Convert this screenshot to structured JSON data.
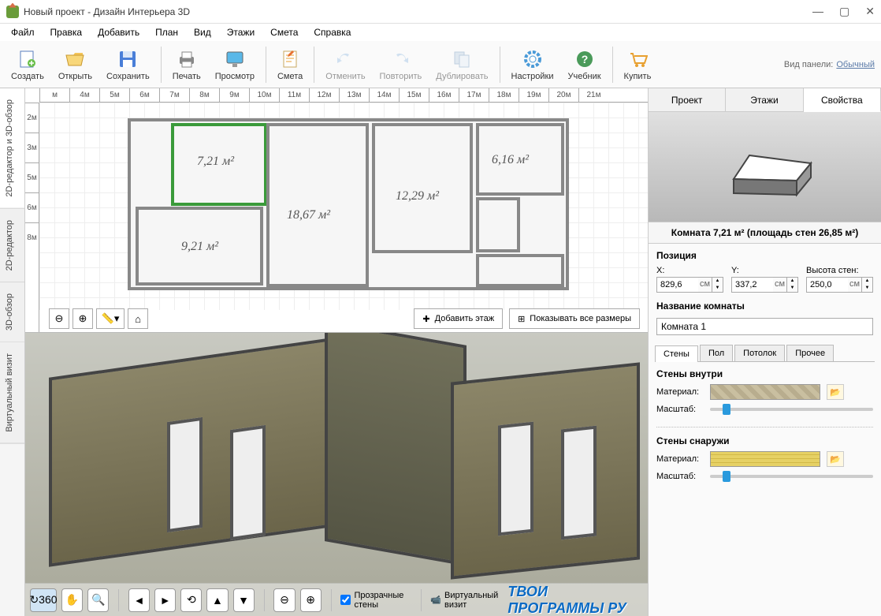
{
  "window": {
    "title": "Новый проект - Дизайн Интерьера 3D"
  },
  "menu": [
    "Файл",
    "Правка",
    "Добавить",
    "План",
    "Вид",
    "Этажи",
    "Смета",
    "Справка"
  ],
  "toolbar": {
    "create": "Создать",
    "open": "Открыть",
    "save": "Сохранить",
    "print": "Печать",
    "preview": "Просмотр",
    "estimate": "Смета",
    "undo": "Отменить",
    "redo": "Повторить",
    "duplicate": "Дублировать",
    "settings": "Настройки",
    "tutorial": "Учебник",
    "buy": "Купить",
    "panel_label": "Вид панели:",
    "panel_link": "Обычный"
  },
  "vtabs": [
    "2D-редактор и 3D-обзор",
    "2D-редактор",
    "3D-обзор",
    "Виртуальный визит"
  ],
  "ruler_h": [
    "м",
    "4м",
    "5м",
    "6м",
    "7м",
    "8м",
    "9м",
    "10м",
    "11м",
    "12м",
    "13м",
    "14м",
    "15м",
    "16м",
    "17м",
    "18м",
    "19м",
    "20м",
    "21м"
  ],
  "ruler_v": [
    "2м",
    "3м",
    "5м",
    "6м",
    "8м"
  ],
  "rooms": {
    "r1": "7,21 м²",
    "r2": "6,16 м²",
    "r3": "12,29 м²",
    "r4": "18,67 м²",
    "r5": "9,21 м²"
  },
  "planbar": {
    "add_floor": "Добавить этаж",
    "show_dims": "Показывать все размеры"
  },
  "bottom": {
    "transparent_walls": "Прозрачные стены",
    "virtual_visit": "Виртуальный визит",
    "watermark": "ТВОИ ПРОГРАММЫ РУ"
  },
  "side": {
    "tabs": [
      "Проект",
      "Этажи",
      "Свойства"
    ],
    "room_title": "Комната 7,21 м²  (площадь стен 26,85 м²)",
    "position_head": "Позиция",
    "labels": {
      "x": "X:",
      "y": "Y:",
      "wall_h": "Высота стен:"
    },
    "pos": {
      "x": "829,6",
      "y": "337,2",
      "h": "250,0",
      "unit": "см"
    },
    "name_head": "Название комнаты",
    "name_value": "Комната 1",
    "sub_tabs": [
      "Стены",
      "Пол",
      "Потолок",
      "Прочее"
    ],
    "walls_inside": "Стены внутри",
    "walls_outside": "Стены снаружи",
    "material": "Материал:",
    "scale": "Масштаб:"
  }
}
